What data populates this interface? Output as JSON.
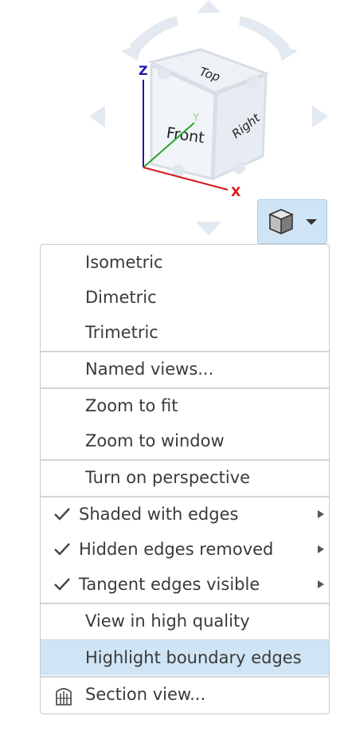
{
  "view_cube": {
    "faces": {
      "top": "Top",
      "front": "Front",
      "right": "Right"
    },
    "axes": {
      "x": "X",
      "y": "Y",
      "z": "Z"
    }
  },
  "menu": {
    "items": [
      {
        "label": "Isometric"
      },
      {
        "label": "Dimetric"
      },
      {
        "label": "Trimetric"
      },
      {
        "label": "Named views..."
      },
      {
        "label": "Zoom to fit"
      },
      {
        "label": "Zoom to window"
      },
      {
        "label": "Turn on perspective"
      },
      {
        "label": "Shaded with edges",
        "checked": true,
        "submenu": true
      },
      {
        "label": "Hidden edges removed",
        "checked": true,
        "submenu": true
      },
      {
        "label": "Tangent edges visible",
        "checked": true,
        "submenu": true
      },
      {
        "label": "View in high quality"
      },
      {
        "label": "Highlight boundary edges",
        "highlighted": true
      },
      {
        "label": "Section view..."
      }
    ]
  },
  "colors": {
    "highlight": "#cfe5f6",
    "axis_x": "#d11a1a",
    "axis_y": "#2aa52a",
    "axis_z": "#1a1aa8"
  }
}
